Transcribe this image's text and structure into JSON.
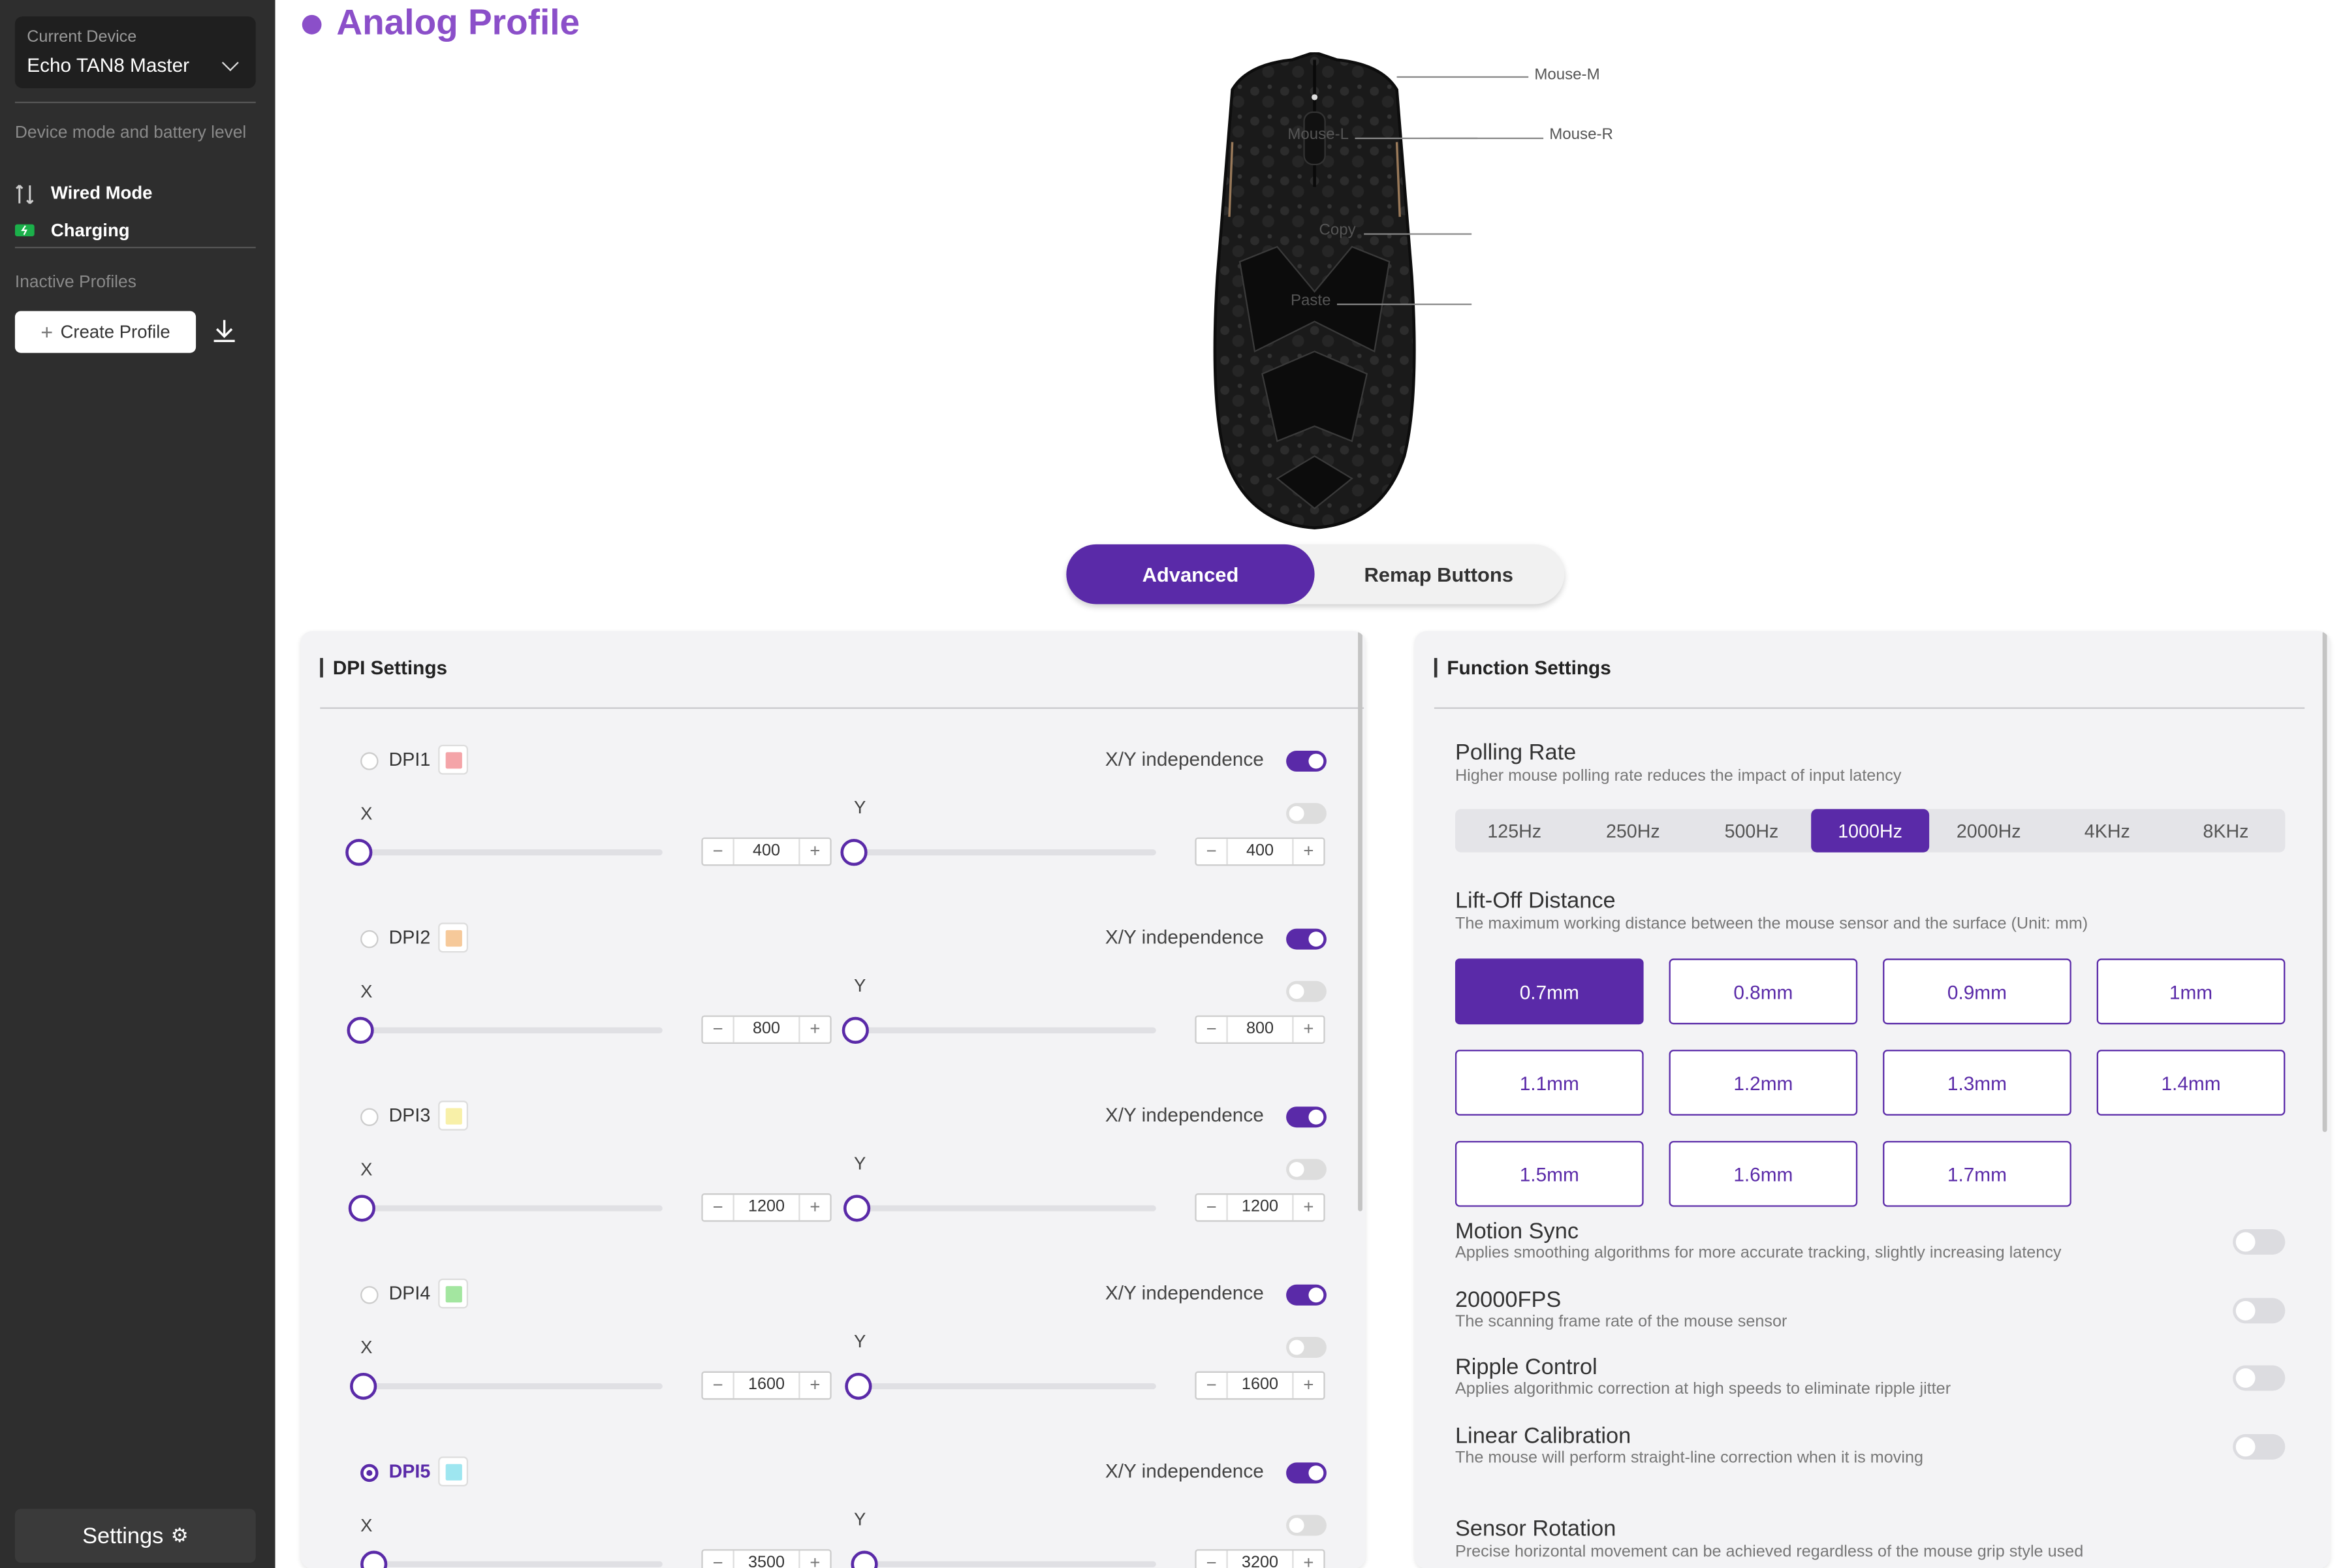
{
  "sidebar": {
    "current_device_label": "Current Device",
    "current_device": "Echo TAN8 Master",
    "device_mode_heading": "Device mode and battery level",
    "mode": "Wired Mode",
    "battery": "Charging",
    "inactive_profiles_heading": "Inactive Profiles",
    "create_profile": "Create Profile",
    "settings": "Settings"
  },
  "page": {
    "title": "Analog Profile"
  },
  "mouse_callouts": {
    "m": "Mouse-M",
    "l": "Mouse-L",
    "r": "Mouse-R",
    "copy": "Copy",
    "paste": "Paste"
  },
  "view_tabs": [
    "Advanced",
    "Remap Buttons"
  ],
  "dpi": {
    "heading": "DPI Settings",
    "xy_label": "X/Y independence",
    "x_label": "X",
    "y_label": "Y",
    "rows": [
      {
        "name": "DPI1",
        "color": "#f4a4a8",
        "x": "400",
        "y": "400",
        "selected": false
      },
      {
        "name": "DPI2",
        "color": "#f6c99a",
        "x": "800",
        "y": "800",
        "selected": false
      },
      {
        "name": "DPI3",
        "color": "#f8f0a8",
        "x": "1200",
        "y": "1200",
        "selected": false
      },
      {
        "name": "DPI4",
        "color": "#a3e6a0",
        "x": "1600",
        "y": "1600",
        "selected": false
      },
      {
        "name": "DPI5",
        "color": "#9ee6f0",
        "x": "3500",
        "y": "3200",
        "selected": true
      }
    ]
  },
  "function": {
    "heading": "Function Settings",
    "polling": {
      "title": "Polling Rate",
      "desc": "Higher mouse polling rate reduces the impact of input latency",
      "options": [
        "125Hz",
        "250Hz",
        "500Hz",
        "1000Hz",
        "2000Hz",
        "4KHz",
        "8KHz"
      ],
      "selected": "1000Hz"
    },
    "liftoff": {
      "title": "Lift-Off Distance",
      "desc": "The maximum working distance between the mouse sensor and the surface (Unit: mm)",
      "options": [
        "0.7mm",
        "0.8mm",
        "0.9mm",
        "1mm",
        "1.1mm",
        "1.2mm",
        "1.3mm",
        "1.4mm",
        "1.5mm",
        "1.6mm",
        "1.7mm"
      ],
      "selected": "0.7mm"
    },
    "toggles": [
      {
        "title": "Motion Sync",
        "desc": "Applies smoothing algorithms for more accurate tracking, slightly increasing latency",
        "on": false
      },
      {
        "title": "20000FPS",
        "desc": "The scanning frame rate of the mouse sensor",
        "on": false
      },
      {
        "title": "Ripple Control",
        "desc": "Applies algorithmic correction at high speeds to eliminate ripple jitter",
        "on": false
      },
      {
        "title": "Linear Calibration",
        "desc": "The mouse will perform straight-line correction when it is moving",
        "on": false
      }
    ],
    "sensor_rotation": {
      "title": "Sensor Rotation",
      "desc": "Precise horizontal movement can be achieved regardless of the mouse grip style used"
    }
  },
  "colors": {
    "accent": "#5a2aa8",
    "title": "#8b4fc9",
    "sidebar_bg": "#2e2e2e"
  }
}
